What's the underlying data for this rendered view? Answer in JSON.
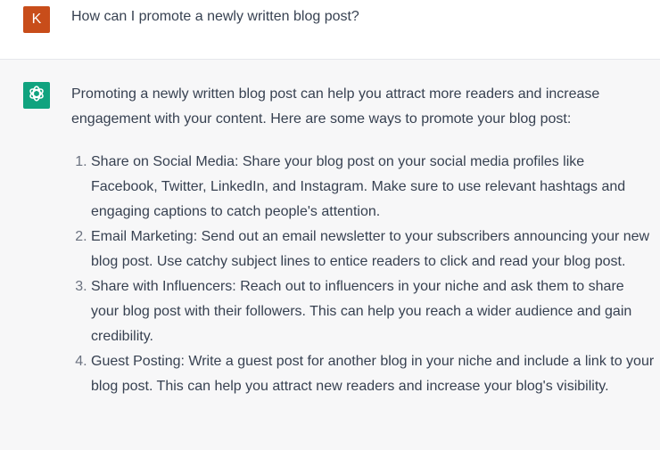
{
  "user": {
    "avatar_letter": "K",
    "avatar_color": "#c84d1a",
    "message": "How can I promote a newly written blog post?"
  },
  "assistant": {
    "avatar_icon": "openai-logo-icon",
    "avatar_color": "#10a37f",
    "intro": "Promoting a newly written blog post can help you attract more readers and increase engagement with your content. Here are some ways to promote your blog post:",
    "items": [
      "Share on Social Media: Share your blog post on your social media profiles like Facebook, Twitter, LinkedIn, and Instagram. Make sure to use relevant hashtags and engaging captions to catch people's attention.",
      "Email Marketing: Send out an email newsletter to your subscribers announcing your new blog post. Use catchy subject lines to entice readers to click and read your blog post.",
      "Share with Influencers: Reach out to influencers in your niche and ask them to share your blog post with their followers. This can help you reach a wider audience and gain credibility.",
      "Guest Posting: Write a guest post for another blog in your niche and include a link to your blog post. This can help you attract new readers and increase your blog's visibility."
    ]
  }
}
